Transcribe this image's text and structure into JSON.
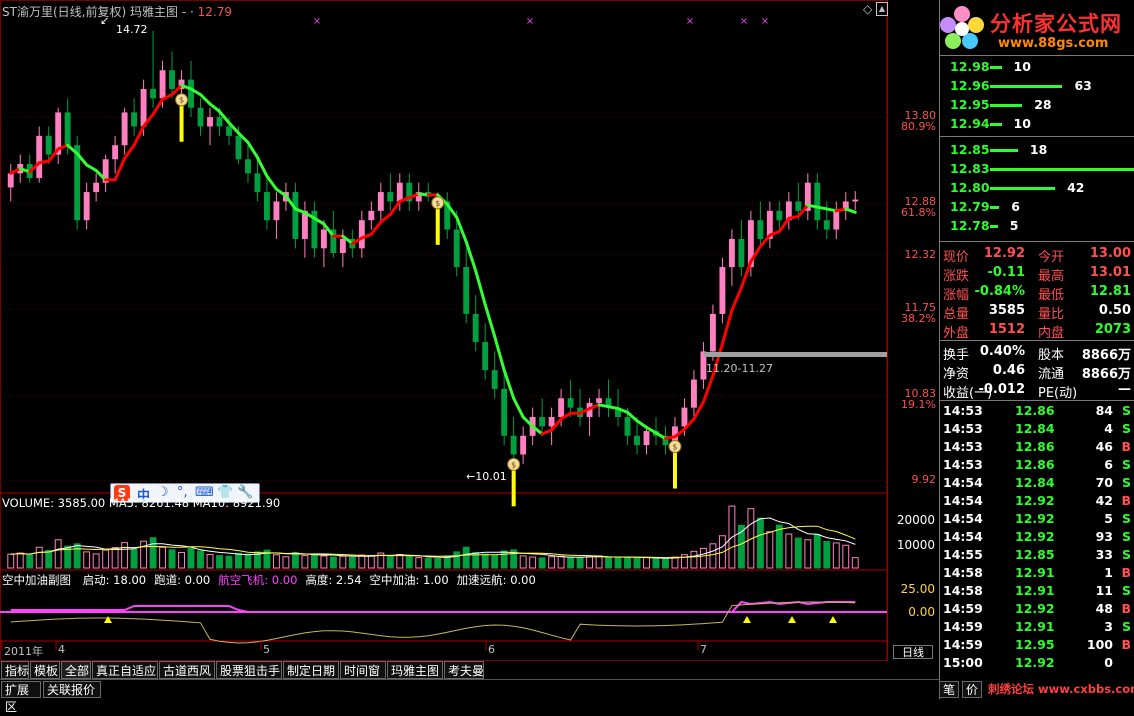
{
  "header": {
    "title": "ST渝万里(日线,前复权)",
    "indicator": "玛雅主图",
    "dash": "-",
    "dot": "·",
    "price": "12.79"
  },
  "price_axis": [
    {
      "price": "13.80",
      "pct": "80.9%"
    },
    {
      "price": "12.88",
      "pct": "61.8%"
    },
    {
      "price": "12.32",
      "pct": ""
    },
    {
      "price": "11.75",
      "pct": "38.2%"
    },
    {
      "price": "10.83",
      "pct": "19.1%"
    },
    {
      "price": "9.92",
      "pct": ""
    }
  ],
  "annotations": {
    "high": "14.72",
    "low": "←10.01",
    "range": "11.20-11.27",
    "high_arrow": "↙"
  },
  "volume_panel": {
    "label": "VOLUME: 3585.00  MA5: 8261.48  MA10: 8921.90",
    "axis": [
      "20000",
      "10000"
    ]
  },
  "indicator_panel": {
    "name": "空中加油副图",
    "fields": [
      {
        "label": "启动: 18.00",
        "color": "#ffffff"
      },
      {
        "label": "跑道: 0.00",
        "color": "#ffffff"
      },
      {
        "label": "航空飞机: 0.00",
        "color": "#ff40ff"
      },
      {
        "label": "高度: 2.54",
        "color": "#ffffff"
      },
      {
        "label": "空中加油: 1.00",
        "color": "#ffffff"
      },
      {
        "label": "加速远航: 0.00",
        "color": "#ffffff"
      }
    ],
    "axis": [
      "25.00",
      "0.00"
    ]
  },
  "dates": [
    {
      "label": "2011年",
      "x": 4
    },
    {
      "label": "4",
      "x": 58
    },
    {
      "label": "5",
      "x": 263
    },
    {
      "label": "6",
      "x": 488
    },
    {
      "label": "7",
      "x": 700
    }
  ],
  "period_label": "日线",
  "ime": {
    "logo": "S",
    "items": [
      "中",
      "☽",
      "°,",
      "⌨",
      "👕",
      "🔧"
    ]
  },
  "tabs": [
    "指标",
    "模板",
    "全部",
    "真正自适应",
    "古道西风",
    "股票狙击手",
    "制定日期",
    "时间窗",
    "玛雅主图",
    "考夫曼"
  ],
  "tabs_row2": [
    "扩展区",
    "关联报价"
  ],
  "logo": {
    "name": "分析家公式网",
    "url": "www.88gs.com"
  },
  "order_book": {
    "asks": [
      {
        "price": "12.98",
        "qty": "10",
        "bar": 10
      },
      {
        "price": "12.96",
        "qty": "63",
        "bar": 63
      },
      {
        "price": "12.95",
        "qty": "28",
        "bar": 28
      },
      {
        "price": "12.94",
        "qty": "10",
        "bar": 10
      }
    ],
    "bids": [
      {
        "price": "12.85",
        "qty": "18",
        "bar": 18
      },
      {
        "price": "12.83",
        "qty": "93",
        "bar": 93
      },
      {
        "price": "12.80",
        "qty": "42",
        "bar": 42
      },
      {
        "price": "12.79",
        "qty": "6",
        "bar": 6
      },
      {
        "price": "12.78",
        "qty": "5",
        "bar": 5
      }
    ]
  },
  "quote": [
    {
      "l1": "现价",
      "v1": "12.92",
      "c1": "#ff5050",
      "l2": "今开",
      "v2": "13.00",
      "c2": "#ff5050"
    },
    {
      "l1": "涨跌",
      "v1": "-0.11",
      "c1": "#2bff2b",
      "l2": "最高",
      "v2": "13.01",
      "c2": "#ff5050"
    },
    {
      "l1": "涨幅",
      "v1": "-0.84%",
      "c1": "#2bff2b",
      "l2": "最低",
      "v2": "12.81",
      "c2": "#2bff2b"
    },
    {
      "l1": "总量",
      "v1": "3585",
      "c1": "#ffffff",
      "l2": "量比",
      "v2": "0.50",
      "c2": "#ffffff"
    },
    {
      "l1": "外盘",
      "v1": "1512",
      "c1": "#ff5050",
      "l2": "内盘",
      "v2": "2073",
      "c2": "#2bff2b"
    }
  ],
  "fundamentals": [
    {
      "l1": "换手",
      "v1": "0.40%",
      "l2": "股本",
      "v2": "8866万"
    },
    {
      "l1": "净资",
      "v1": "0.46",
      "l2": "流通",
      "v2": "8866万"
    },
    {
      "l1": "收益(一)",
      "v1": "-0.012",
      "l2": "PE(动)",
      "v2": "—"
    }
  ],
  "ticks": [
    {
      "t": "14:53",
      "p": "12.86",
      "v": "84",
      "s": "S"
    },
    {
      "t": "14:53",
      "p": "12.84",
      "v": "4",
      "s": "S"
    },
    {
      "t": "14:53",
      "p": "12.86",
      "v": "46",
      "s": "B"
    },
    {
      "t": "14:53",
      "p": "12.86",
      "v": "6",
      "s": "S"
    },
    {
      "t": "14:54",
      "p": "12.84",
      "v": "70",
      "s": "S"
    },
    {
      "t": "14:54",
      "p": "12.92",
      "v": "42",
      "s": "B"
    },
    {
      "t": "14:54",
      "p": "12.92",
      "v": "5",
      "s": "S"
    },
    {
      "t": "14:54",
      "p": "12.92",
      "v": "93",
      "s": "S"
    },
    {
      "t": "14:55",
      "p": "12.85",
      "v": "33",
      "s": "S"
    },
    {
      "t": "14:58",
      "p": "12.91",
      "v": "1",
      "s": "B"
    },
    {
      "t": "14:58",
      "p": "12.91",
      "v": "11",
      "s": "S"
    },
    {
      "t": "14:59",
      "p": "12.92",
      "v": "48",
      "s": "B"
    },
    {
      "t": "14:59",
      "p": "12.91",
      "v": "3",
      "s": "S"
    },
    {
      "t": "14:59",
      "p": "12.95",
      "v": "100",
      "s": "B"
    },
    {
      "t": "15:00",
      "p": "12.92",
      "v": "0",
      "s": ""
    }
  ],
  "bottom_right": {
    "left": "笔",
    "mid": "价",
    "watermark": "刺绣论坛 www.cxbbs.com"
  },
  "colors": {
    "up": "#ff80c0",
    "down": "#00a040",
    "ma_up": "#ff0000",
    "ma_down": "#33ff33",
    "grid": "#7a0000"
  },
  "chart_data": {
    "type": "candlestick",
    "ylim": [
      9.8,
      14.9
    ],
    "candles": [
      [
        13.05,
        13.3,
        12.9,
        13.2
      ],
      [
        13.2,
        13.4,
        13.1,
        13.3
      ],
      [
        13.3,
        13.4,
        13.1,
        13.15
      ],
      [
        13.15,
        13.7,
        13.1,
        13.6
      ],
      [
        13.6,
        13.7,
        13.3,
        13.4
      ],
      [
        13.4,
        13.9,
        13.3,
        13.85
      ],
      [
        13.85,
        14.0,
        13.4,
        13.5
      ],
      [
        13.5,
        13.6,
        12.6,
        12.7
      ],
      [
        12.7,
        13.1,
        12.6,
        13.0
      ],
      [
        13.0,
        13.2,
        12.9,
        13.1
      ],
      [
        13.1,
        13.4,
        13.0,
        13.35
      ],
      [
        13.35,
        13.6,
        13.2,
        13.5
      ],
      [
        13.5,
        13.9,
        13.4,
        13.85
      ],
      [
        13.85,
        14.0,
        13.6,
        13.7
      ],
      [
        13.7,
        14.2,
        13.6,
        14.1
      ],
      [
        14.1,
        14.72,
        13.9,
        14.0
      ],
      [
        14.0,
        14.4,
        13.9,
        14.3
      ],
      [
        14.3,
        14.5,
        14.0,
        14.1
      ],
      [
        14.1,
        14.3,
        13.9,
        14.2
      ],
      [
        14.2,
        14.4,
        13.8,
        13.9
      ],
      [
        13.9,
        14.0,
        13.6,
        13.7
      ],
      [
        13.7,
        13.9,
        13.5,
        13.8
      ],
      [
        13.8,
        13.9,
        13.6,
        13.7
      ],
      [
        13.7,
        13.8,
        13.5,
        13.6
      ],
      [
        13.6,
        13.7,
        13.3,
        13.35
      ],
      [
        13.35,
        13.5,
        13.1,
        13.2
      ],
      [
        13.2,
        13.4,
        12.9,
        13.0
      ],
      [
        13.0,
        13.2,
        12.6,
        12.7
      ],
      [
        12.7,
        13.0,
        12.5,
        12.9
      ],
      [
        12.9,
        13.1,
        12.8,
        13.0
      ],
      [
        13.0,
        13.1,
        12.4,
        12.5
      ],
      [
        12.5,
        12.9,
        12.3,
        12.8
      ],
      [
        12.8,
        12.9,
        12.3,
        12.4
      ],
      [
        12.4,
        12.7,
        12.2,
        12.6
      ],
      [
        12.6,
        12.8,
        12.3,
        12.35
      ],
      [
        12.35,
        12.6,
        12.2,
        12.5
      ],
      [
        12.5,
        12.6,
        12.3,
        12.4
      ],
      [
        12.4,
        12.8,
        12.3,
        12.7
      ],
      [
        12.7,
        12.9,
        12.6,
        12.8
      ],
      [
        12.8,
        13.1,
        12.7,
        13.0
      ],
      [
        13.0,
        13.2,
        12.8,
        12.9
      ],
      [
        12.9,
        13.2,
        12.8,
        13.1
      ],
      [
        13.1,
        13.2,
        12.8,
        12.9
      ],
      [
        12.9,
        13.1,
        12.8,
        13.0
      ],
      [
        13.0,
        13.1,
        12.9,
        12.95
      ],
      [
        12.95,
        13.0,
        12.8,
        12.9
      ],
      [
        12.9,
        13.0,
        12.5,
        12.6
      ],
      [
        12.6,
        12.8,
        12.1,
        12.2
      ],
      [
        12.2,
        12.4,
        11.6,
        11.7
      ],
      [
        11.7,
        11.9,
        11.3,
        11.4
      ],
      [
        11.4,
        11.6,
        11.0,
        11.1
      ],
      [
        11.1,
        11.3,
        10.8,
        10.9
      ],
      [
        10.9,
        11.1,
        10.3,
        10.4
      ],
      [
        10.4,
        10.6,
        10.01,
        10.2
      ],
      [
        10.2,
        10.5,
        10.1,
        10.4
      ],
      [
        10.4,
        10.7,
        10.3,
        10.6
      ],
      [
        10.6,
        10.8,
        10.4,
        10.5
      ],
      [
        10.5,
        10.7,
        10.3,
        10.6
      ],
      [
        10.6,
        10.9,
        10.5,
        10.8
      ],
      [
        10.8,
        11.0,
        10.6,
        10.7
      ],
      [
        10.7,
        10.9,
        10.5,
        10.6
      ],
      [
        10.6,
        10.8,
        10.4,
        10.75
      ],
      [
        10.75,
        10.9,
        10.6,
        10.8
      ],
      [
        10.8,
        11.0,
        10.6,
        10.7
      ],
      [
        10.7,
        10.9,
        10.5,
        10.6
      ],
      [
        10.6,
        10.7,
        10.3,
        10.4
      ],
      [
        10.4,
        10.6,
        10.2,
        10.3
      ],
      [
        10.3,
        10.5,
        10.2,
        10.45
      ],
      [
        10.45,
        10.6,
        10.3,
        10.4
      ],
      [
        10.4,
        10.5,
        10.2,
        10.3
      ],
      [
        10.3,
        10.6,
        10.2,
        10.5
      ],
      [
        10.5,
        10.8,
        10.4,
        10.7
      ],
      [
        10.7,
        11.1,
        10.6,
        11.0
      ],
      [
        11.0,
        11.4,
        10.9,
        11.3
      ],
      [
        11.3,
        11.8,
        11.2,
        11.7
      ],
      [
        11.7,
        12.3,
        11.6,
        12.2
      ],
      [
        12.2,
        12.6,
        12.0,
        12.5
      ],
      [
        12.5,
        12.7,
        12.1,
        12.2
      ],
      [
        12.2,
        12.8,
        12.1,
        12.7
      ],
      [
        12.7,
        12.9,
        12.4,
        12.5
      ],
      [
        12.5,
        12.9,
        12.4,
        12.8
      ],
      [
        12.8,
        12.9,
        12.6,
        12.7
      ],
      [
        12.7,
        13.0,
        12.6,
        12.9
      ],
      [
        12.9,
        13.1,
        12.7,
        12.8
      ],
      [
        12.8,
        13.2,
        12.7,
        13.1
      ],
      [
        13.1,
        13.2,
        12.6,
        12.7
      ],
      [
        12.7,
        12.9,
        12.5,
        12.6
      ],
      [
        12.6,
        12.9,
        12.5,
        12.8
      ],
      [
        12.8,
        13.0,
        12.7,
        12.9
      ],
      [
        12.9,
        13.01,
        12.81,
        12.92
      ]
    ],
    "volumes": [
      4800,
      5200,
      4500,
      7200,
      6100,
      9800,
      7600,
      8400,
      5600,
      4900,
      6200,
      7100,
      8800,
      6400,
      9300,
      10500,
      7200,
      6300,
      5400,
      6800,
      5900,
      4700,
      4300,
      4100,
      5100,
      4800,
      5600,
      6200,
      4600,
      3900,
      5400,
      4300,
      4800,
      4200,
      3800,
      4100,
      3700,
      4500,
      4300,
      5200,
      4100,
      4700,
      3900,
      3600,
      3400,
      3300,
      4200,
      5600,
      7200,
      5400,
      4800,
      4300,
      5900,
      6300,
      4200,
      3800,
      3500,
      3900,
      4100,
      3700,
      3600,
      3900,
      4200,
      3800,
      3600,
      3500,
      3400,
      3700,
      3300,
      3200,
      3800,
      4600,
      5800,
      6800,
      8400,
      11200,
      21500,
      14800,
      20600,
      17300,
      12600,
      14900,
      11800,
      10400,
      9800,
      11600,
      9200,
      8700,
      7900,
      3585
    ]
  }
}
